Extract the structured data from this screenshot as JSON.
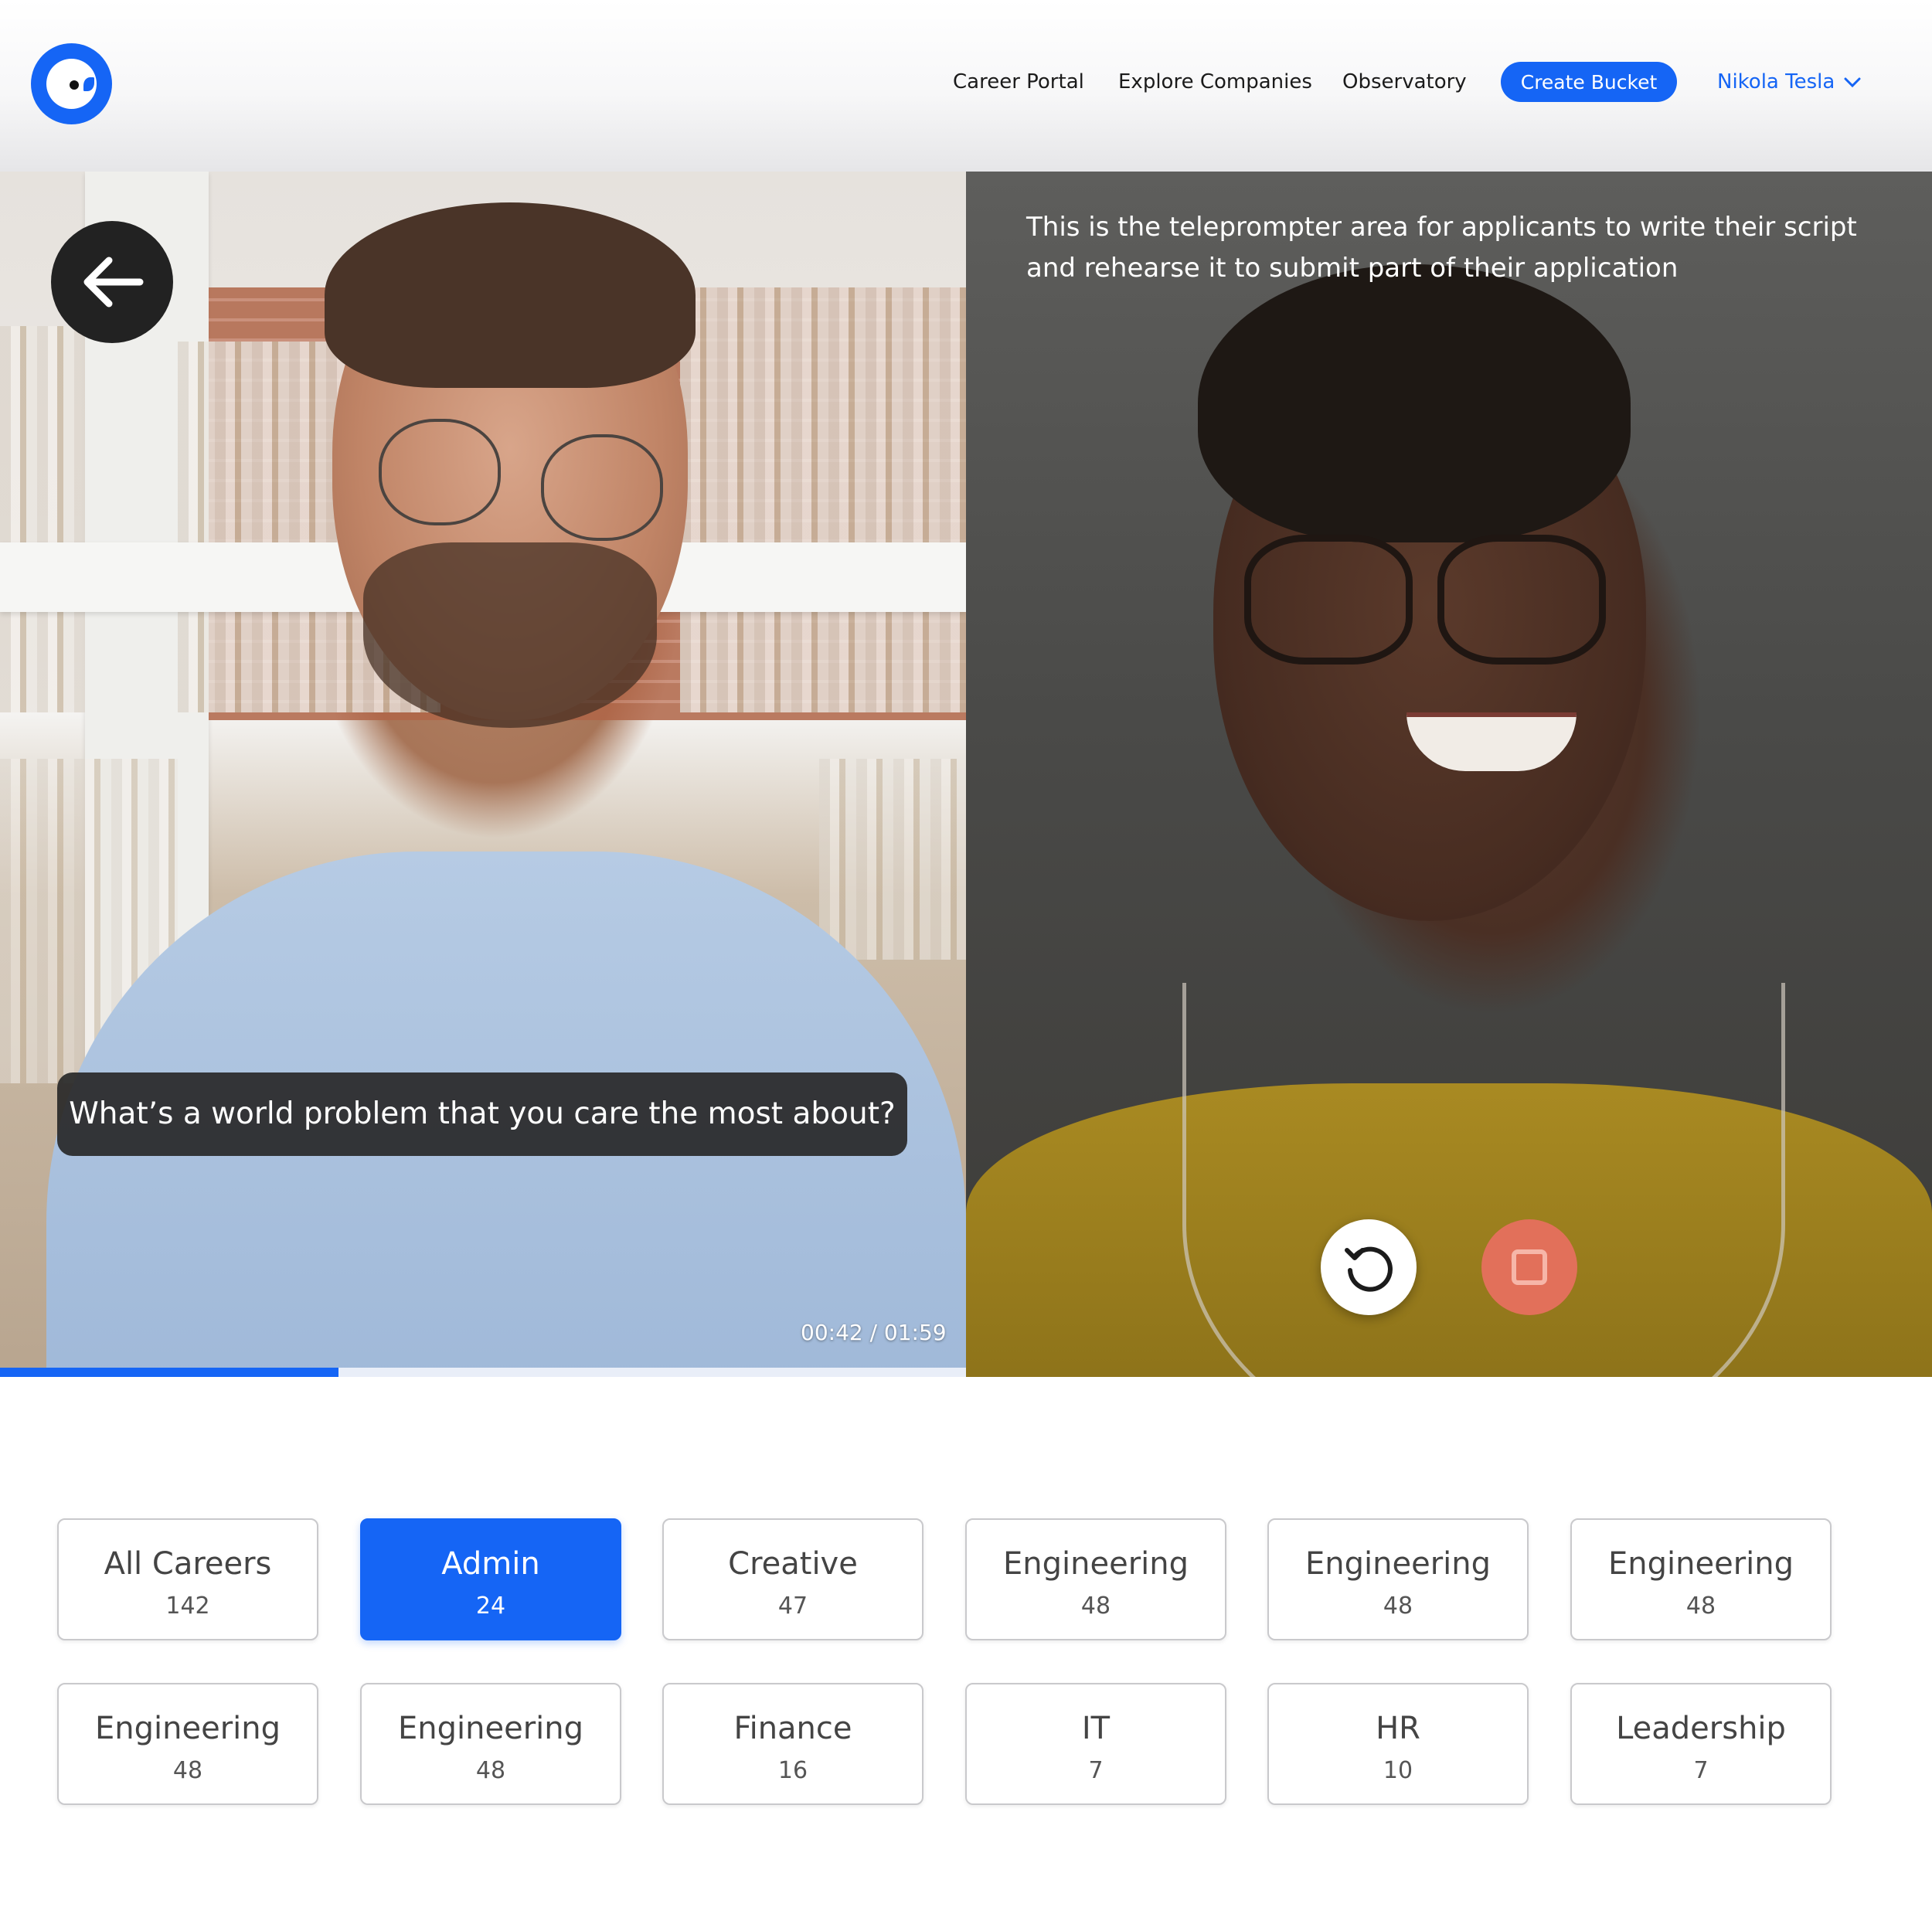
{
  "header": {
    "logo": "owl-logo",
    "nav": [
      {
        "label": "Career Portal"
      },
      {
        "label": "Explore Companies"
      },
      {
        "label": "Observatory"
      }
    ],
    "create_button": "Create Bucket",
    "user_name": "Nikola Tesla"
  },
  "interviewer_video": {
    "question": "What’s a world problem that you care the most about?",
    "timecode": "00:42 / 01:59",
    "progress": 0.35
  },
  "applicant_video": {
    "teleprompter_text": "This is the teleprompter area for applicants to write their script and rehearse it to submit part of their application",
    "controls": [
      "replay-icon",
      "stop-record-icon"
    ]
  },
  "categories": [
    {
      "label": "All Careers",
      "count": "142",
      "active": false
    },
    {
      "label": "Admin",
      "count": "24",
      "active": true
    },
    {
      "label": "Creative",
      "count": "47",
      "active": false
    },
    {
      "label": "Engineering",
      "count": "48",
      "active": false
    },
    {
      "label": "Engineering",
      "count": "48",
      "active": false
    },
    {
      "label": "Engineering",
      "count": "48",
      "active": false
    },
    {
      "label": "Engineering",
      "count": "48",
      "active": false
    },
    {
      "label": "Engineering",
      "count": "48",
      "active": false
    },
    {
      "label": "Finance",
      "count": "16",
      "active": false
    },
    {
      "label": "IT",
      "count": "7",
      "active": false
    },
    {
      "label": "HR",
      "count": "10",
      "active": false
    },
    {
      "label": "Leadership",
      "count": "7",
      "active": false
    }
  ],
  "colors": {
    "accent": "#1565f5",
    "record_red": "#e2705a"
  }
}
